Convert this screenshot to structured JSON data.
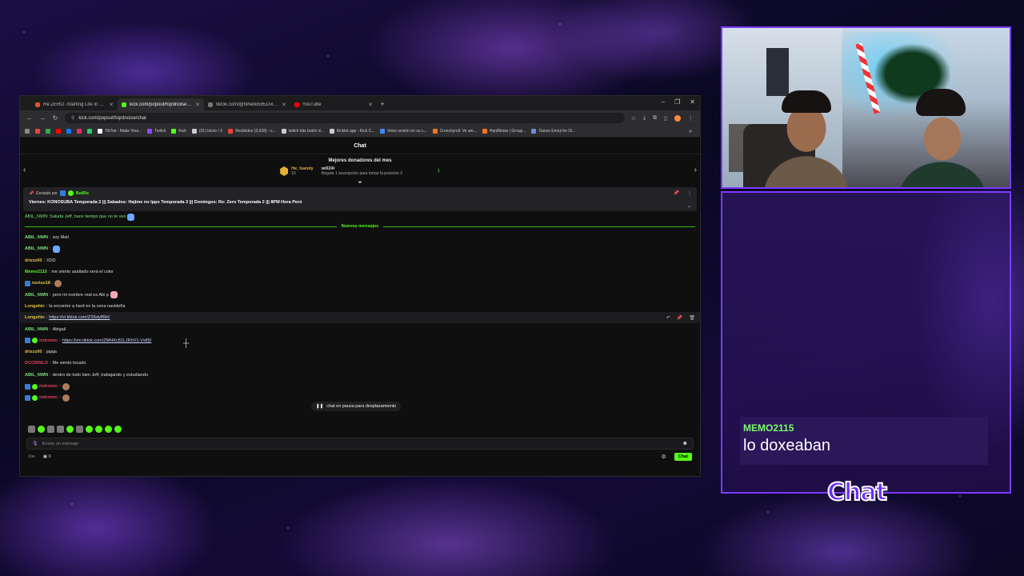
{
  "browser": {
    "tabs": [
      {
        "title": "Re:ZERO -Starting Life in Anot...",
        "color": "#e0522b",
        "active": false
      },
      {
        "title": "kick.com/popout/hqrdnoise/ch...",
        "color": "#53fc18",
        "active": true
      },
      {
        "title": "tiktok.com/@hihello5851/vide...",
        "color": "#777777",
        "active": false
      },
      {
        "title": "YouTube",
        "color": "#ff0000",
        "active": false
      }
    ],
    "url": "kick.com/popout/hqrdnoise/chat",
    "bookmarks": [
      {
        "label": "TikTok - Make Your...",
        "color": "#ffffff"
      },
      {
        "label": "Twitch",
        "color": "#9146ff"
      },
      {
        "label": "Kick",
        "color": "#53fc18"
      },
      {
        "label": "(31) Inicio / X",
        "color": "#cccccc"
      },
      {
        "label": "Recibidos (3,628) - c...",
        "color": "#ea4335"
      },
      {
        "label": "twitch bits botón d...",
        "color": "#cccccc"
      },
      {
        "label": "Kicklet.app - Kick C...",
        "color": "#cccccc"
      },
      {
        "label": "Inicie sesión en su c...",
        "color": "#4285f4"
      },
      {
        "label": "Crunchyroll: Ve ani...",
        "color": "#f47521"
      },
      {
        "label": "HqrdNoise | Group...",
        "color": "#f47521"
      },
      {
        "label": "Dance Emoji for Di...",
        "color": "#7289da"
      }
    ]
  },
  "chat": {
    "header": "Chat",
    "donors_title": "Mejores donadores del mes",
    "donor1": {
      "name": "He_Isandy",
      "amount": "15"
    },
    "donor2": {
      "name": "will24l",
      "sub": "Regala 1 suscripción para tomar la posición 3"
    },
    "donor_count": "1",
    "pinned": {
      "by_label": "Enviado por",
      "by_user": "BotRix",
      "text": "Viernes: KONOSUBA Temporada 2 ||| Sabados: Hajime no Ippo Temporada 3 ||| Domingos: Re: Zero Temporada 2 ||| 8PM Hora Perú"
    },
    "partial_top": "ABIL_NWN: Saluda Jeff, hace tiempo que no te veo",
    "new_messages_label": "Nuevos mensajes",
    "messages": [
      {
        "user": "ABIL_NWN",
        "color": "#7ae27a",
        "text": "soy Marl"
      },
      {
        "user": "ABIL_NWN",
        "color": "#7ae27a",
        "text": ""
      },
      {
        "user": "drizzz00",
        "color": "#e3c34a",
        "text": "XDD"
      },
      {
        "user": "Memo2115",
        "color": "#53fc18",
        "text": "me siento asaltado será el color"
      },
      {
        "user": "norius18",
        "color": "#e3c34a",
        "text": ""
      },
      {
        "user": "ABIL_NWN",
        "color": "#7ae27a",
        "text": "pero mi nombre real es Abi p"
      },
      {
        "user": "Longshin",
        "color": "#e3c34a",
        "text": "la encontre a hard en la cena navideña"
      },
      {
        "user": "Longshin",
        "color": "#e3c34a",
        "link": "https://vt.tiktok.com/ZS5dyff9H/"
      },
      {
        "user": "ABIL_NWN",
        "color": "#7ae27a",
        "text": "Abigail"
      },
      {
        "user": "mdrmmc",
        "color": "#e0405a",
        "link": "https://vm.tiktok.com/ZMHKc81LJRhV1-Vx85/"
      },
      {
        "user": "drizzz00",
        "color": "#e3c34a",
        "text": "jajaja"
      },
      {
        "user": "DCCRINLO",
        "color": "#e0405a",
        "text": "Me siento tocado"
      },
      {
        "user": "ABIL_NWN",
        "color": "#7ae27a",
        "text": "dentro de todo bien Jeff, trabajando y estudiando"
      },
      {
        "user": "mdrmmc",
        "color": "#e0405a",
        "text": ""
      },
      {
        "user": "mdrmmc",
        "color": "#e0405a",
        "text": ""
      }
    ],
    "paused_label": "chat en pausa para desplazamiento",
    "input_placeholder": "Enviar un mensaje",
    "viewer_count": "0",
    "send_label": "Chat"
  },
  "overlay": {
    "popup_user": "MEMO2115",
    "popup_text": "lo doxeaban",
    "chat_label": "Chat"
  }
}
